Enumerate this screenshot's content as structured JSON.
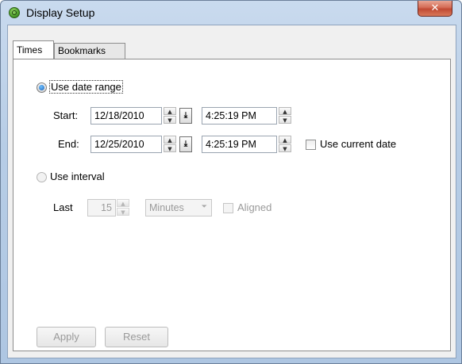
{
  "window": {
    "title": "Display Setup",
    "close_glyph": "✕",
    "icon": "app-globe-icon"
  },
  "tabs": [
    {
      "label": "Times",
      "active": true
    },
    {
      "label": "Bookmarks",
      "active": false
    }
  ],
  "date_range": {
    "label": "Use date range",
    "selected": true,
    "start_label": "Start:",
    "start_date": "12/18/2010",
    "start_time": "4:25:19 PM",
    "end_label": "End:",
    "end_date": "12/25/2010",
    "end_time": "4:25:19 PM",
    "use_current_date_label": "Use current date",
    "use_current_date_checked": false
  },
  "interval": {
    "label": "Use interval",
    "selected": false,
    "last_label": "Last",
    "last_value": "15",
    "unit": "Minutes",
    "aligned_label": "Aligned",
    "aligned_checked": false
  },
  "buttons": {
    "apply": "Apply",
    "reset": "Reset"
  },
  "glyphs": {
    "spin_up": "▲",
    "spin_down": "▼",
    "dropdown": "⏷",
    "download": "⤓"
  }
}
